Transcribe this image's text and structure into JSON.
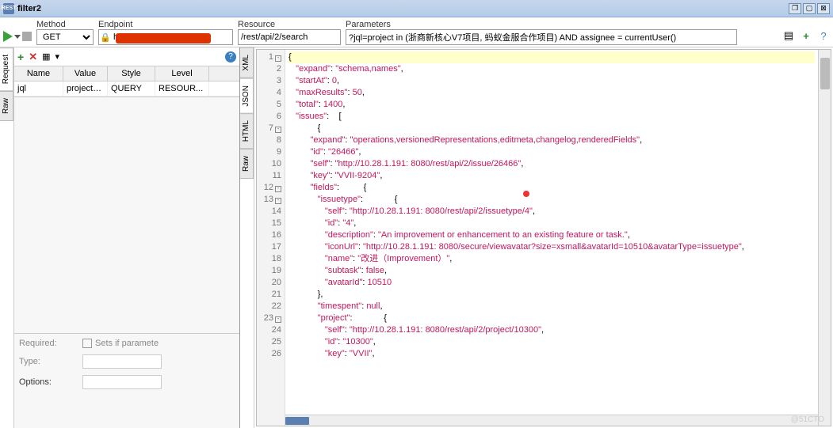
{
  "titlebar": {
    "logo": "REST",
    "title": "filter2"
  },
  "toolbar": {
    "method_label": "Method",
    "method_value": "GET",
    "endpoint_label": "Endpoint",
    "endpoint_value": "htt",
    "resource_label": "Resource",
    "resource_value": "/rest/api/2/search",
    "params_label": "Parameters",
    "params_value": "?jql=project in (浙商新核心V7项目, 蚂蚁金服合作项目) AND assignee = currentUser()"
  },
  "left": {
    "tabs": [
      "Request",
      "Raw"
    ],
    "headers": [
      "Name",
      "Value",
      "Style",
      "Level"
    ],
    "row": {
      "name": "jql",
      "value": "project i...",
      "style": "QUERY",
      "level": "RESOUR..."
    },
    "props": {
      "required": "Required:",
      "sets_if": "Sets if paramete",
      "type": "Type:",
      "options": "Options:"
    }
  },
  "right_tabs": [
    "XML",
    "JSON",
    "HTML",
    "Raw"
  ],
  "code_lines": [
    {
      "n": 1,
      "fold": "-",
      "t": "{"
    },
    {
      "n": 2,
      "t": "   \"expand\": \"schema,names\","
    },
    {
      "n": 3,
      "t": "   \"startAt\": 0,"
    },
    {
      "n": 4,
      "t": "   \"maxResults\": 50,"
    },
    {
      "n": 5,
      "t": "   \"total\": 1400,"
    },
    {
      "n": 6,
      "t": "   \"issues\":    ["
    },
    {
      "n": 7,
      "fold": "-",
      "t": "            {"
    },
    {
      "n": 8,
      "t": "         \"expand\": \"operations,versionedRepresentations,editmeta,changelog,renderedFields\","
    },
    {
      "n": 9,
      "t": "         \"id\": \"26466\","
    },
    {
      "n": 10,
      "t": "         \"self\": \"http://10.28.1.191:8080/rest/api/2/issue/26466\","
    },
    {
      "n": 11,
      "t": "         \"key\": \"VVII-9204\","
    },
    {
      "n": 12,
      "fold": "-",
      "t": "         \"fields\":          {"
    },
    {
      "n": 13,
      "fold": "-",
      "t": "            \"issuetype\":             {"
    },
    {
      "n": 14,
      "t": "               \"self\": \"http://10.28.1.191:8080/rest/api/2/issuetype/4\","
    },
    {
      "n": 15,
      "t": "               \"id\": \"4\","
    },
    {
      "n": 16,
      "t": "               \"description\": \"An improvement or enhancement to an existing feature or task.\","
    },
    {
      "n": 17,
      "t": "               \"iconUrl\": \"http://10.28.1.191:8080/secure/viewavatar?size=xsmall&avatarId=10510&avatarType=issuetype\","
    },
    {
      "n": 18,
      "t": "               \"name\": \"改进（Improvement）\","
    },
    {
      "n": 19,
      "t": "               \"subtask\": false,"
    },
    {
      "n": 20,
      "t": "               \"avatarId\": 10510"
    },
    {
      "n": 21,
      "t": "            },"
    },
    {
      "n": 22,
      "t": "            \"timespent\": null,"
    },
    {
      "n": 23,
      "fold": "-",
      "t": "            \"project\":             {"
    },
    {
      "n": 24,
      "t": "               \"self\": \"http://10.28.1.191:8080/rest/api/2/project/10300\","
    },
    {
      "n": 25,
      "t": "               \"id\": \"10300\","
    },
    {
      "n": 26,
      "t": "               \"key\": \"VVII\","
    }
  ],
  "watermark": "@51CTO"
}
